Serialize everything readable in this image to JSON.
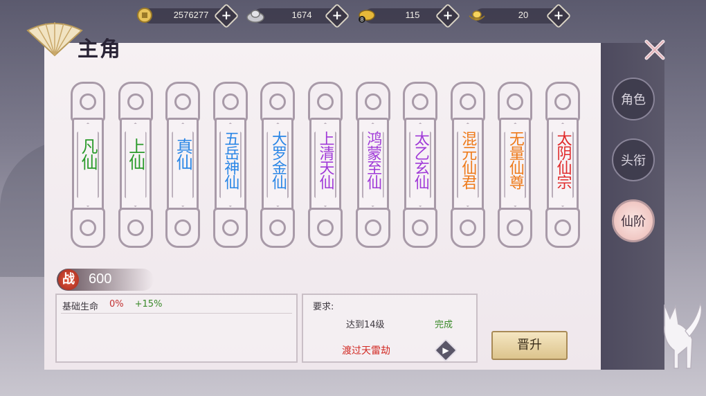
{
  "currencies": [
    {
      "name": "coin-icon",
      "value": "2576277"
    },
    {
      "name": "silver-ingot-icon",
      "value": "1674"
    },
    {
      "name": "gold-ingot-icon",
      "value": "115",
      "badge": "8"
    },
    {
      "name": "yuanbao-icon",
      "value": "20"
    }
  ],
  "header": {
    "title": "主角"
  },
  "tabs": [
    {
      "label": "角色",
      "active": false
    },
    {
      "label": "头衔",
      "active": false
    },
    {
      "label": "仙阶",
      "active": true
    }
  ],
  "ranks": [
    {
      "label": "凡仙",
      "color": "#2a9a2a"
    },
    {
      "label": "上仙",
      "color": "#2a9a2a"
    },
    {
      "label": "真仙",
      "color": "#2a86e6"
    },
    {
      "label": "五岳神仙",
      "color": "#2a86e6"
    },
    {
      "label": "大罗金仙",
      "color": "#2a86e6"
    },
    {
      "label": "上清天仙",
      "color": "#a03ad8"
    },
    {
      "label": "鸿蒙至仙",
      "color": "#a03ad8"
    },
    {
      "label": "太乙玄仙",
      "color": "#a03ad8"
    },
    {
      "label": "混元仙君",
      "color": "#ee7a1a"
    },
    {
      "label": "无量仙尊",
      "color": "#ee7a1a"
    },
    {
      "label": "太阴仙宗",
      "color": "#e02a2a"
    }
  ],
  "power": {
    "badge": "战",
    "value": "600"
  },
  "stats": {
    "label": "基础生命",
    "current": "0%",
    "bonus": "+15%"
  },
  "requirements": {
    "title": "要求:",
    "items": [
      {
        "text": "达到14级",
        "status": "完成"
      },
      {
        "text": "渡过天雷劫"
      }
    ]
  },
  "upgrade": {
    "label": "晋升"
  }
}
